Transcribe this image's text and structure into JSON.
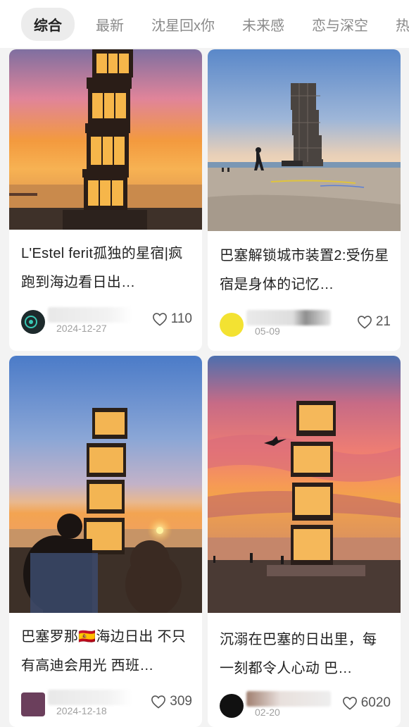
{
  "tabs": [
    "综合",
    "最新",
    "沈星回x你",
    "未来感",
    "恋与深空",
    "热"
  ],
  "posts": [
    {
      "title": "L'Estel ferit孤独的星宿|疯跑到海边看日出…",
      "date": "2024-12-27",
      "likes": "110"
    },
    {
      "title": "巴塞解锁城市装置2:受伤星宿是身体的记忆…",
      "date": "05-09",
      "likes": "21"
    },
    {
      "title": "巴塞罗那🇪🇸海边日出 不只有高迪会用光 西班…",
      "date": "2024-12-18",
      "likes": "309"
    },
    {
      "title": "沉溺在巴塞的日出里，每一刻都令人心动 巴…",
      "date": "02-20",
      "likes": "6020"
    }
  ]
}
